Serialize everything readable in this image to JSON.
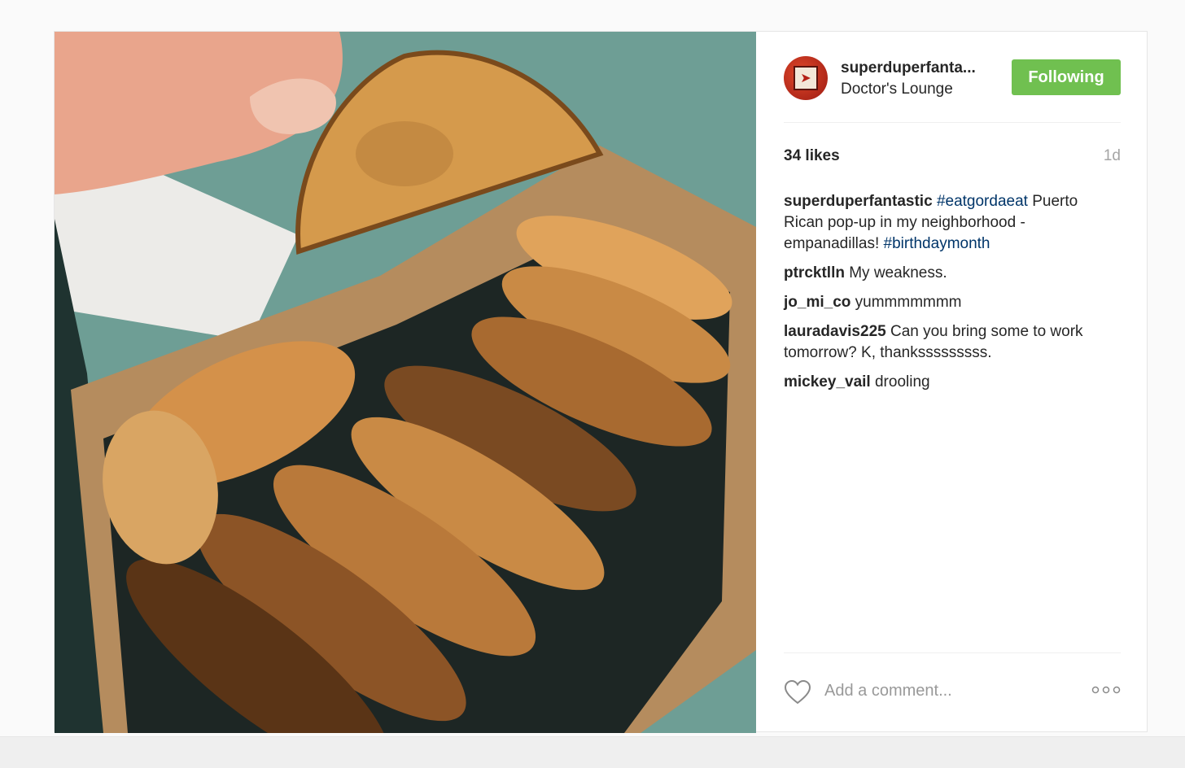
{
  "post": {
    "username": "superduperfanta...",
    "location": "Doctor's Lounge",
    "follow_label": "Following",
    "likes": "34 likes",
    "time": "1d",
    "caption": {
      "user": "superduperfantastic",
      "parts": [
        {
          "text": " "
        },
        {
          "tag": "#eatgordaeat"
        },
        {
          "text": " Puerto Rican pop-up in my neighborhood - empanadillas! "
        },
        {
          "tag": "#birthdaymonth"
        }
      ]
    },
    "comments": [
      {
        "user": "ptrcktlln",
        "text": "My weakness."
      },
      {
        "user": "jo_mi_co",
        "text": "yummmmmmm"
      },
      {
        "user": "lauradavis225",
        "text": "Can you bring some to work tomorrow? K, thanksssssssss."
      },
      {
        "user": "mickey_vail",
        "text": "drooling"
      }
    ],
    "add_comment_placeholder": "Add a comment..."
  },
  "icons": {
    "heart": "heart-icon",
    "more": "more-options-icon",
    "avatar": "avatar"
  },
  "colors": {
    "follow_green": "#70c050",
    "hashtag_blue": "#003569",
    "muted": "#999999"
  }
}
